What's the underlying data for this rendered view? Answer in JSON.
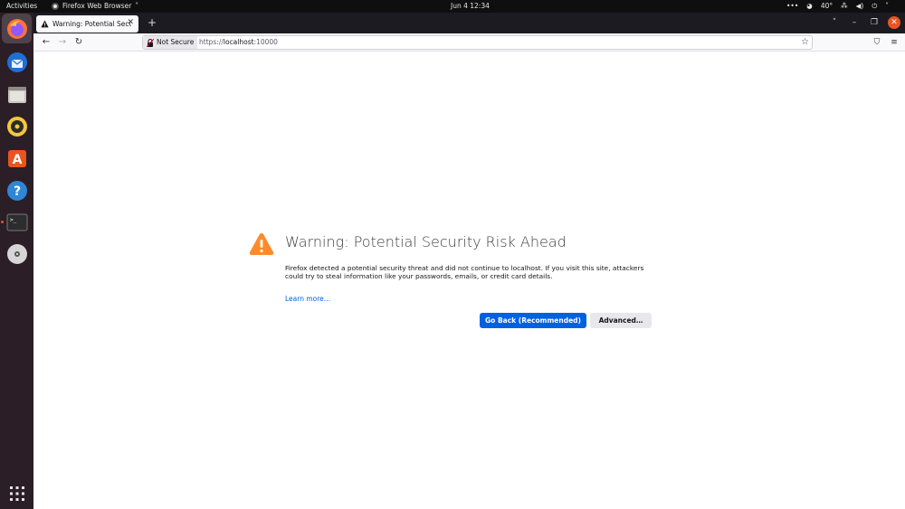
{
  "topbar": {
    "activities": "Activities",
    "app_name": "Firefox Web Browser",
    "app_menu_arrow": "˅",
    "clock": "Jun 4  12:34",
    "weather": "40°",
    "tray_icons": [
      "more-icon",
      "weather-icon",
      "network-icon",
      "volume-icon",
      "power-icon"
    ]
  },
  "dock": {
    "apps": [
      {
        "name": "firefox",
        "active": true
      },
      {
        "name": "thunderbird"
      },
      {
        "name": "files"
      },
      {
        "name": "rhythmbox"
      },
      {
        "name": "app-center"
      },
      {
        "name": "help"
      },
      {
        "name": "terminal",
        "running": true
      },
      {
        "name": "disc"
      }
    ],
    "show_apps": "show-apps-icon"
  },
  "browser": {
    "tab_title": "Warning: Potential Security Risk Ahead",
    "tab_title_visible": "Warning: Potential Secu",
    "new_tab": "+",
    "url": {
      "prefix": "https://",
      "host": "localhost",
      "port": ":10000"
    },
    "not_secure_label": "Not Secure"
  },
  "page": {
    "title": "Warning: Potential Security Risk Ahead",
    "description": "Firefox detected a potential security threat and did not continue to localhost. If you visit this site, attackers could try to steal information like your passwords, emails, or credit card details.",
    "learn_more": "Learn more…",
    "go_back": "Go Back (Recommended)",
    "advanced": "Advanced…"
  },
  "colors": {
    "accent": "#0061e0",
    "warning": "#ff8a2b",
    "ubuntu_orange": "#e95420"
  }
}
